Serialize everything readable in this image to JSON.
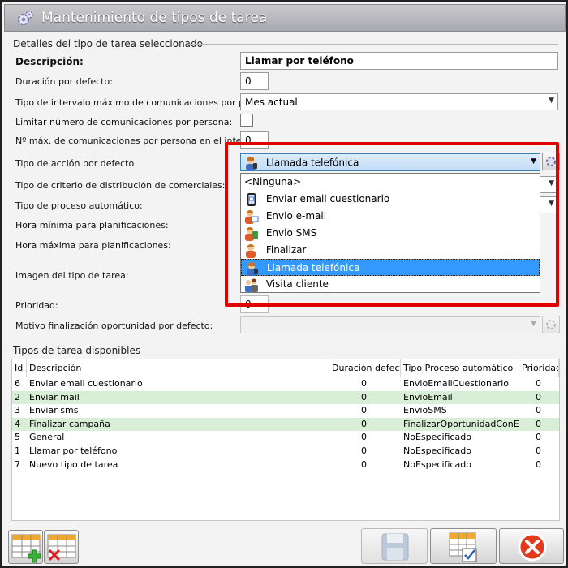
{
  "window": {
    "title": "Mantenimiento de tipos de tarea",
    "icon": "gear-icon"
  },
  "details": {
    "section_title": "Detalles del tipo de tarea seleccionado",
    "descripcion_label": "Descripción:",
    "descripcion_value": "Llamar por teléfono",
    "duracion_label": "Duración por defecto:",
    "duracion_value": "0",
    "intervalo_label": "Tipo de intervalo máximo de comunicaciones por persona:",
    "intervalo_value": "Mes actual",
    "limitar_label": "Limitar número de comunicaciones por persona:",
    "nmax_label": "Nº máx. de comunicaciones por persona en el intervalo:",
    "nmax_value": "0",
    "accion_label": "Tipo de acción por defecto",
    "accion_value": "Llamada telefónica",
    "criterio_label": "Tipo de criterio de distribución de comerciales:",
    "proceso_label": "Tipo de proceso automático:",
    "hora_min_label": "Hora mínima para planificaciones:",
    "hora_max_label": "Hora máxima para planificaciones:",
    "imagen_label": "Imagen del tipo de tarea:",
    "prioridad_label": "Prioridad:",
    "prioridad_value": "0",
    "motivo_label": "Motivo finalización oportunidad por defecto:",
    "motivo_value": ""
  },
  "dropdown": {
    "options": [
      {
        "label": "<Ninguna>",
        "icon": ""
      },
      {
        "label": "Enviar email cuestionario",
        "icon": "mobile-email-icon"
      },
      {
        "label": "Envio e-mail",
        "icon": "user-email-icon"
      },
      {
        "label": "Envio SMS",
        "icon": "user-sms-icon"
      },
      {
        "label": "Finalizar",
        "icon": "user-finish-icon"
      },
      {
        "label": "Llamada telefónica",
        "icon": "user-phone-icon"
      },
      {
        "label": "Visita cliente",
        "icon": "users-visit-icon"
      }
    ],
    "selected_index": 5
  },
  "table": {
    "section_title": "Tipos de tarea disponibles",
    "headers": [
      "Id",
      "Descripción",
      "Duración defecto",
      "Tipo Proceso automático",
      "Prioridad"
    ],
    "rows": [
      [
        "6",
        "Enviar email cuestionario",
        "0",
        "EnvioEmailCuestionario",
        "0"
      ],
      [
        "2",
        "Enviar mail",
        "0",
        "EnvioEmail",
        "0"
      ],
      [
        "3",
        "Enviar sms",
        "0",
        "EnvioSMS",
        "0"
      ],
      [
        "4",
        "Finalizar campaña",
        "0",
        "FinalizarOportunidadConExito",
        "0"
      ],
      [
        "5",
        "General",
        "0",
        "NoEspecificado",
        "0"
      ],
      [
        "1",
        "Llamar por teléfono",
        "0",
        "NoEspecificado",
        "0"
      ],
      [
        "7",
        "Nuevo tipo de tarea",
        "0",
        "NoEspecificado",
        "0"
      ]
    ],
    "highlighted_rows": [
      1,
      3
    ]
  },
  "colors": {
    "highlight": "#e00000",
    "selected": "#3399ff",
    "alt_row": "#d9eed6"
  }
}
